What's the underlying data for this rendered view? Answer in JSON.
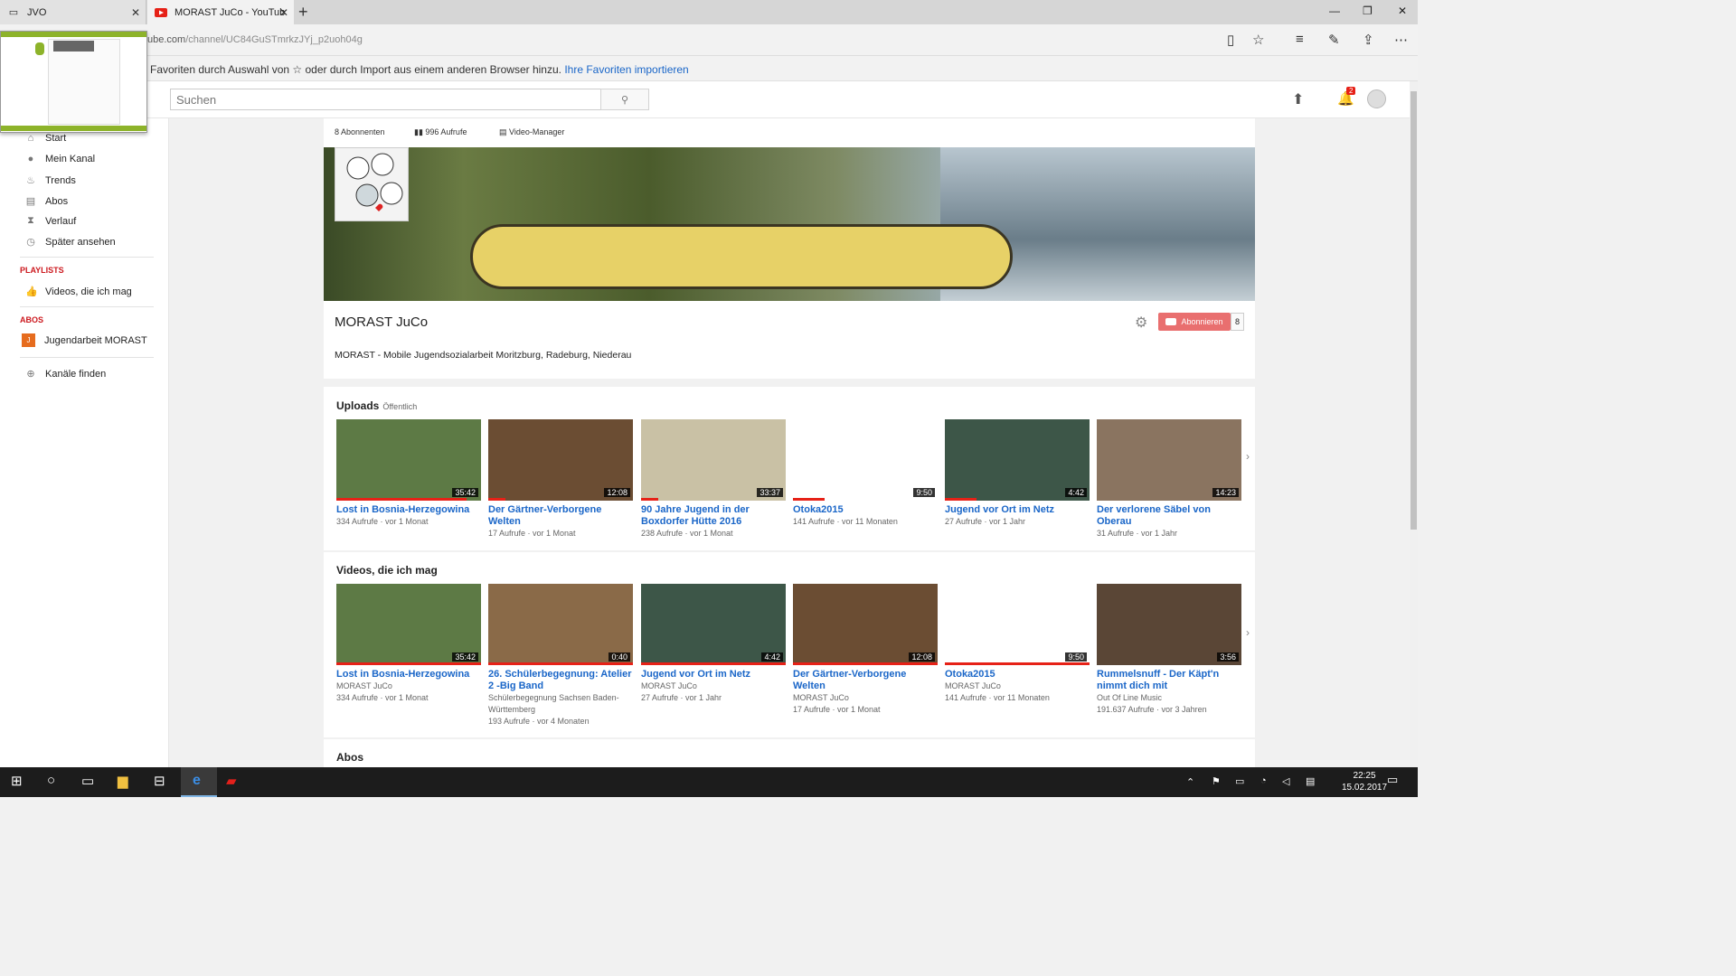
{
  "browser": {
    "tabs": [
      {
        "label": "JVO"
      },
      {
        "label": "MORAST JuCo - YouTub"
      }
    ],
    "url_host": "ube.com",
    "url_path": "/channel/UC84GuSTmrkzJYj_p2uoh04g",
    "favorites_bar_text": "Favoriten durch Auswahl von ☆ oder durch Import aus einem anderen Browser hinzu.",
    "favorites_import_link": "Ihre Favoriten importieren"
  },
  "youtube": {
    "search_placeholder": "Suchen",
    "notification_count": "2"
  },
  "sidebar": {
    "items": [
      {
        "label": "Start",
        "icon": "home-icon"
      },
      {
        "label": "Mein Kanal",
        "icon": "user-icon"
      },
      {
        "label": "Trends",
        "icon": "flame-icon"
      },
      {
        "label": "Abos",
        "icon": "subscriptions-icon"
      },
      {
        "label": "Verlauf",
        "icon": "hourglass-icon"
      },
      {
        "label": "Später ansehen",
        "icon": "clock-icon"
      }
    ],
    "playlists_heading": "PLAYLISTS",
    "playlists": [
      {
        "label": "Videos, die ich mag",
        "icon": "thumbs-up-icon"
      }
    ],
    "abos_heading": "ABOS",
    "abos": [
      {
        "label": "Jugendarbeit MORAST",
        "badge": "J"
      }
    ],
    "find_channels": "Kanäle finden"
  },
  "channel": {
    "subscribers": "8 Abonnenten",
    "views": "996 Aufrufe",
    "video_manager": "Video-Manager",
    "title": "MORAST JuCo",
    "subscribe_label": "Abonnieren",
    "subscribe_count": "8",
    "description": "MORAST - Mobile Jugendsozialarbeit Moritzburg, Radeburg, Niederau"
  },
  "uploads": {
    "title": "Uploads",
    "visibility": "Öffentlich",
    "videos": [
      {
        "title": "Lost in Bosnia-Herzegowina",
        "meta1": "334 Aufrufe  ·  vor 1 Monat",
        "meta2": "",
        "meta3": "",
        "duration": "35:42",
        "progress": 0.9,
        "color": "#5d7a45"
      },
      {
        "title": "Der Gärtner-Verborgene Welten",
        "meta1": "17 Aufrufe  ·  vor 1 Monat",
        "meta2": "",
        "meta3": "",
        "duration": "12:08",
        "progress": 0.12,
        "color": "#6b4d33"
      },
      {
        "title": "90 Jahre Jugend in der Boxdorfer Hütte 2016",
        "meta1": "238 Aufrufe  ·  vor 1 Monat",
        "meta2": "",
        "meta3": "",
        "duration": "33:37",
        "progress": 0.12,
        "color": "#c9c1a5"
      },
      {
        "title": "Otoka2015",
        "meta1": "141 Aufrufe  ·  vor 11 Monaten",
        "meta2": "",
        "meta3": "",
        "duration": "9:50",
        "progress": 0.22,
        "color": "#ffffff"
      },
      {
        "title": "Jugend vor Ort im Netz",
        "meta1": "27 Aufrufe  ·  vor 1 Jahr",
        "meta2": "",
        "meta3": "",
        "duration": "4:42",
        "progress": 0.22,
        "color": "#3d5648"
      },
      {
        "title": "Der verlorene Säbel von Oberau",
        "meta1": "31 Aufrufe  ·  vor 1 Jahr",
        "meta2": "",
        "meta3": "",
        "duration": "14:23",
        "progress": 0.0,
        "color": "#8a7460"
      }
    ]
  },
  "liked": {
    "title": "Videos, die ich mag",
    "videos": [
      {
        "title": "Lost in Bosnia-Herzegowina",
        "meta1": "MORAST JuCo",
        "meta2": "334 Aufrufe  ·  vor 1 Monat",
        "meta3": "",
        "duration": "35:42",
        "progress": 1.0,
        "color": "#5d7a45"
      },
      {
        "title": "26. Schülerbegegnung: Atelier 2 -Big Band",
        "meta1": "Schülerbegegnung Sachsen Baden-Württemberg",
        "meta2": "193 Aufrufe  ·  vor 4 Monaten",
        "meta3": "",
        "duration": "0:40",
        "progress": 1.0,
        "color": "#8a6a48"
      },
      {
        "title": "Jugend vor Ort im Netz",
        "meta1": "MORAST JuCo",
        "meta2": "27 Aufrufe  ·  vor 1 Jahr",
        "meta3": "",
        "duration": "4:42",
        "progress": 1.0,
        "color": "#3d5648"
      },
      {
        "title": "Der Gärtner-Verborgene Welten",
        "meta1": "MORAST JuCo",
        "meta2": "17 Aufrufe  ·  vor 1 Monat",
        "meta3": "",
        "duration": "12:08",
        "progress": 1.0,
        "color": "#6b4d33"
      },
      {
        "title": "Otoka2015",
        "meta1": "MORAST JuCo",
        "meta2": "141 Aufrufe  ·  vor 11 Monaten",
        "meta3": "",
        "duration": "9:50",
        "progress": 1.0,
        "color": "#ffffff"
      },
      {
        "title": "Rummelsnuff - Der Käpt'n nimmt dich mit",
        "meta1": "Out Of Line Music",
        "meta2": "191.637 Aufrufe  ·  vor 3 Jahren",
        "meta3": "",
        "duration": "3:56",
        "progress": 0.0,
        "color": "#5a4636"
      }
    ]
  },
  "abos_shelf": {
    "title": "Abos"
  },
  "taskbar": {
    "time": "22:25",
    "date": "15.02.2017"
  }
}
